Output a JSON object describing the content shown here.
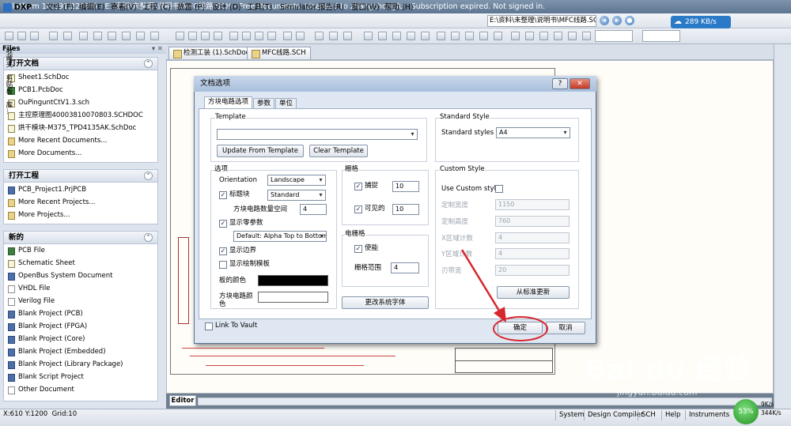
{
  "window": {
    "title": "(Platform 10.391.22084) - E:\\资料\\未整理\\说明书\\MFC线路.SCH - Free Documents. Licensed to zhangchongfu - Subscription expired. Not signed in."
  },
  "menubar": {
    "items": [
      "DXP",
      "文件 (F)",
      "编辑(E)",
      "察看(V)",
      "工程 (C)",
      "放置 (P)",
      "设计 (D)",
      "工具(T)",
      "Simulator",
      "报告(R)",
      "窗口(W)",
      "帮助 (H)"
    ],
    "path": "E:\\资料\\未整理\\说明书\\MFC线路.SCH",
    "net_speed": "289 KB/s"
  },
  "files_panel": {
    "title": "Files",
    "groups": [
      {
        "title": "打开文档",
        "items": [
          "Sheet1.SchDoc",
          "PCB1.PcbDoc",
          "OuPinguntCtV1.3.sch",
          "主控原理图40003810070803.SCHDOC",
          "烘干模块-M375_TPD4135AK.SchDoc",
          "More Recent Documents...",
          "More Documents..."
        ]
      },
      {
        "title": "打开工程",
        "items": [
          "PCB_Project1.PrjPCB",
          "More Recent Projects...",
          "More Projects..."
        ]
      },
      {
        "title": "新的",
        "items": [
          "PCB File",
          "Schematic Sheet",
          "OpenBus System Document",
          "VHDL File",
          "Verilog File",
          "Blank Project (PCB)",
          "Blank Project (FPGA)",
          "Blank Project (Core)",
          "Blank Project (Embedded)",
          "Blank Project (Library Package)",
          "Blank Script Project",
          "Other Document"
        ]
      }
    ]
  },
  "doc_tabs": [
    "检测工装 (1).SchDoc",
    "MFC线路.SCH"
  ],
  "right_strip": [
    "收藏夹",
    "剪贴板",
    "库..."
  ],
  "dialog": {
    "title": "文档选项",
    "tabs": [
      "方块电路选项",
      "参数",
      "单位"
    ],
    "template": {
      "label": "Template",
      "value": "",
      "update_button": "Update From Template",
      "clear_button": "Clear Template"
    },
    "standard_style": {
      "label": "Standard Style",
      "styles_label": "Standard styles",
      "value": "A4"
    },
    "options": {
      "label": "选项",
      "orientation_label": "Orientation",
      "orientation_value": "Landscape",
      "title_block_label": "标题块",
      "title_block_value": "Standard",
      "sheet_count_label": "方块电路数量空间",
      "sheet_count_value": "4",
      "show_ref_zones_label": "显示零参数",
      "ref_zones_value": "Default: Alpha Top to Bottom,",
      "show_border_label": "显示边界",
      "show_template_label": "显示绘制模板",
      "border_color_label": "板的颜色",
      "border_color": "#000000",
      "sheet_color_label": "方块电路颜色",
      "sheet_color": "#ffffff"
    },
    "grids": {
      "label": "栅格",
      "snap_label": "捕捉",
      "snap_value": "10",
      "visible_label": "可见的",
      "visible_value": "10"
    },
    "electrical_grid": {
      "label": "电栅格",
      "enable_label": "使能",
      "range_label": "栅格范围",
      "range_value": "4"
    },
    "change_font_button": "更改系统字体",
    "custom_style": {
      "label": "Custom Style",
      "use_custom_label": "Use Custom style",
      "width_label": "定制宽度",
      "width_value": "1150",
      "height_label": "定制高度",
      "height_value": "760",
      "xzones_label": "X区域计数",
      "xzones_value": "4",
      "yzones_label": "Y区域计数",
      "yzones_value": "4",
      "margin_label": "刃带宽",
      "margin_value": "20",
      "update_button": "从标准更新"
    },
    "link_to_vault": "Link To Vault",
    "ok_button": "确定",
    "cancel_button": "取消"
  },
  "editor_tab": "Editor",
  "statusbar": {
    "coords": "X:610 Y:1200",
    "grid": "Grid:10",
    "buttons": [
      "System",
      "Design Compiler",
      "SCH",
      "Help",
      "Instruments"
    ],
    "speed_percent": "53%",
    "up_speed": "9K/s",
    "down_speed": "344K/s"
  },
  "watermark": {
    "brand": "Bai du 经验",
    "url": "jingyan.baidu.com"
  },
  "colors": {
    "annotation_red": "#d8262d",
    "dialog_bg": "#dfe7f2",
    "title_bar": "#6f86a3"
  }
}
